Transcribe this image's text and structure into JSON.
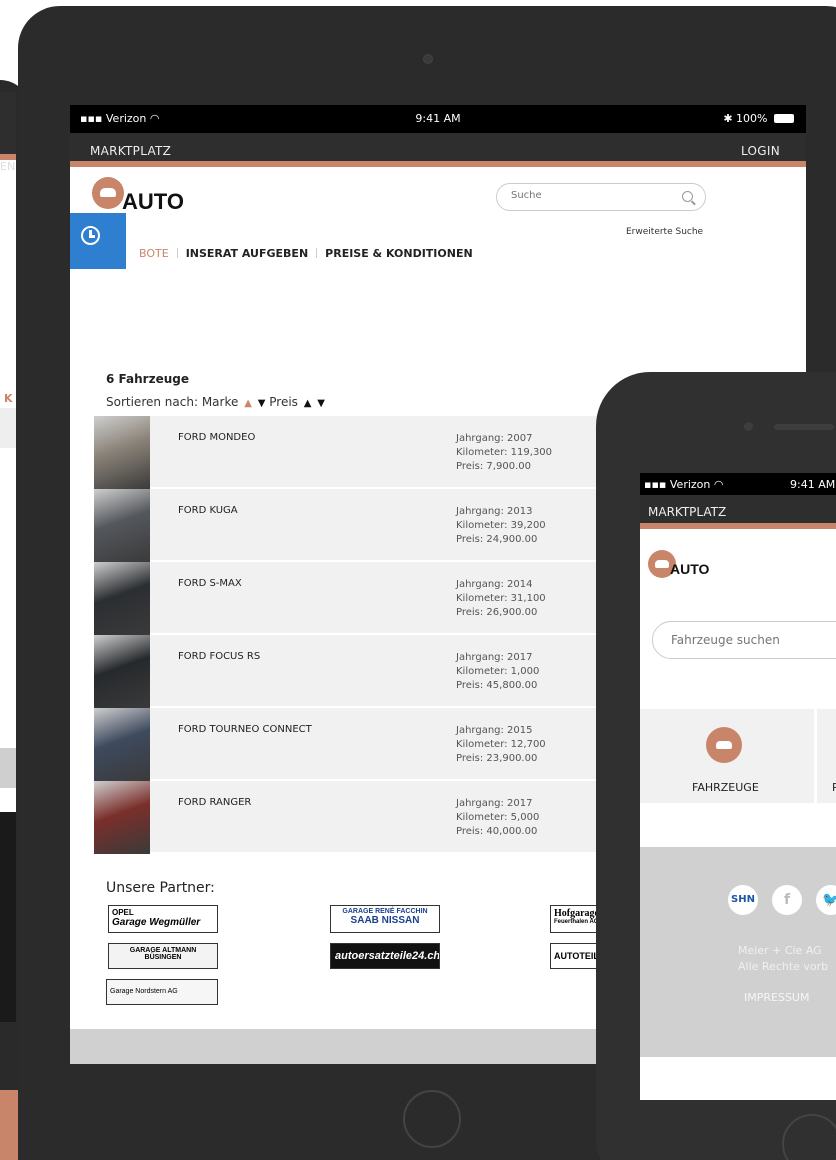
{
  "colors": {
    "accent": "#c9856a",
    "topbar": "#2e2e2e",
    "clock_button": "#2f7fd0",
    "row_bg": "#f1f1f1"
  },
  "background_device": {
    "login_fragment": "EN",
    "link_fragment": "K"
  },
  "tablet": {
    "status": {
      "carrier": "Verizon",
      "time": "9:41 AM",
      "battery": "100%"
    },
    "topnav": {
      "brand": "MARKTPLATZ",
      "login": "LOGIN"
    },
    "logo_text": "AUTO",
    "search": {
      "placeholder": "Suche",
      "advanced": "Erweiterte Suche"
    },
    "nav": {
      "items": [
        "BOTE",
        "INSERAT AUFGEBEN",
        "PREISE & KONDITIONEN"
      ]
    },
    "count": "6 Fahrzeuge",
    "sort": {
      "label": "Sortieren nach:",
      "brand": "Marke",
      "price": "Preis"
    },
    "vehicles": [
      {
        "name": "FORD MONDEO",
        "year": "Jahrgang: 2007",
        "km": "Kilometer: 119,300",
        "price": "Preis: 7,900.00",
        "thumb": "#8a8278"
      },
      {
        "name": "FORD KUGA",
        "year": "Jahrgang: 2013",
        "km": "Kilometer: 39,200",
        "price": "Preis: 24,900.00",
        "thumb": "#54575c"
      },
      {
        "name": "FORD S-MAX",
        "year": "Jahrgang: 2014",
        "km": "Kilometer: 31,100",
        "price": "Preis: 26,900.00",
        "thumb": "#2b2e32"
      },
      {
        "name": "FORD FOCUS RS",
        "year": "Jahrgang: 2017",
        "km": "Kilometer: 1,000",
        "price": "Preis: 45,800.00",
        "thumb": "#26292c"
      },
      {
        "name": "FORD TOURNEO CONNECT",
        "year": "Jahrgang: 2015",
        "km": "Kilometer: 12,700",
        "price": "Preis: 23,900.00",
        "thumb": "#3e4a5e"
      },
      {
        "name": "FORD RANGER",
        "year": "Jahrgang: 2017",
        "km": "Kilometer: 5,000",
        "price": "Preis: 40,000.00",
        "thumb": "#7a2f2a"
      }
    ],
    "partners_title": "Unsere Partner:",
    "partners": {
      "wegmueller": [
        "OPEL",
        "Garage Wegmüller"
      ],
      "facchin": [
        "GARAGE RENÉ FACCHIN",
        "SAAB   NISSAN"
      ],
      "hofgarage": [
        "Hofgarage",
        "Feuerthalen AG"
      ],
      "altmann": [
        "GARAGE ALTMANN",
        "BÜSINGEN"
      ],
      "autoersatzteile": "autoersatzteile24.ch",
      "autoteile": "AUTOTEILE",
      "nordstern": "Garage Nordstern AG"
    }
  },
  "phone": {
    "status": {
      "carrier": "Verizon",
      "time": "9:41 AM"
    },
    "brand": "MARKTPLATZ",
    "logo_text": "AUTO",
    "search_placeholder": "Fahrzeuge suchen",
    "tile_label": "FAHRZEUGE",
    "tile_partial": "P",
    "social_shn": "SHN",
    "social_facebook": "f",
    "copyright_line1": "Meier + Cie AG",
    "copyright_line2": "Alle Rechte vorb",
    "impressum": "IMPRESSUM"
  }
}
